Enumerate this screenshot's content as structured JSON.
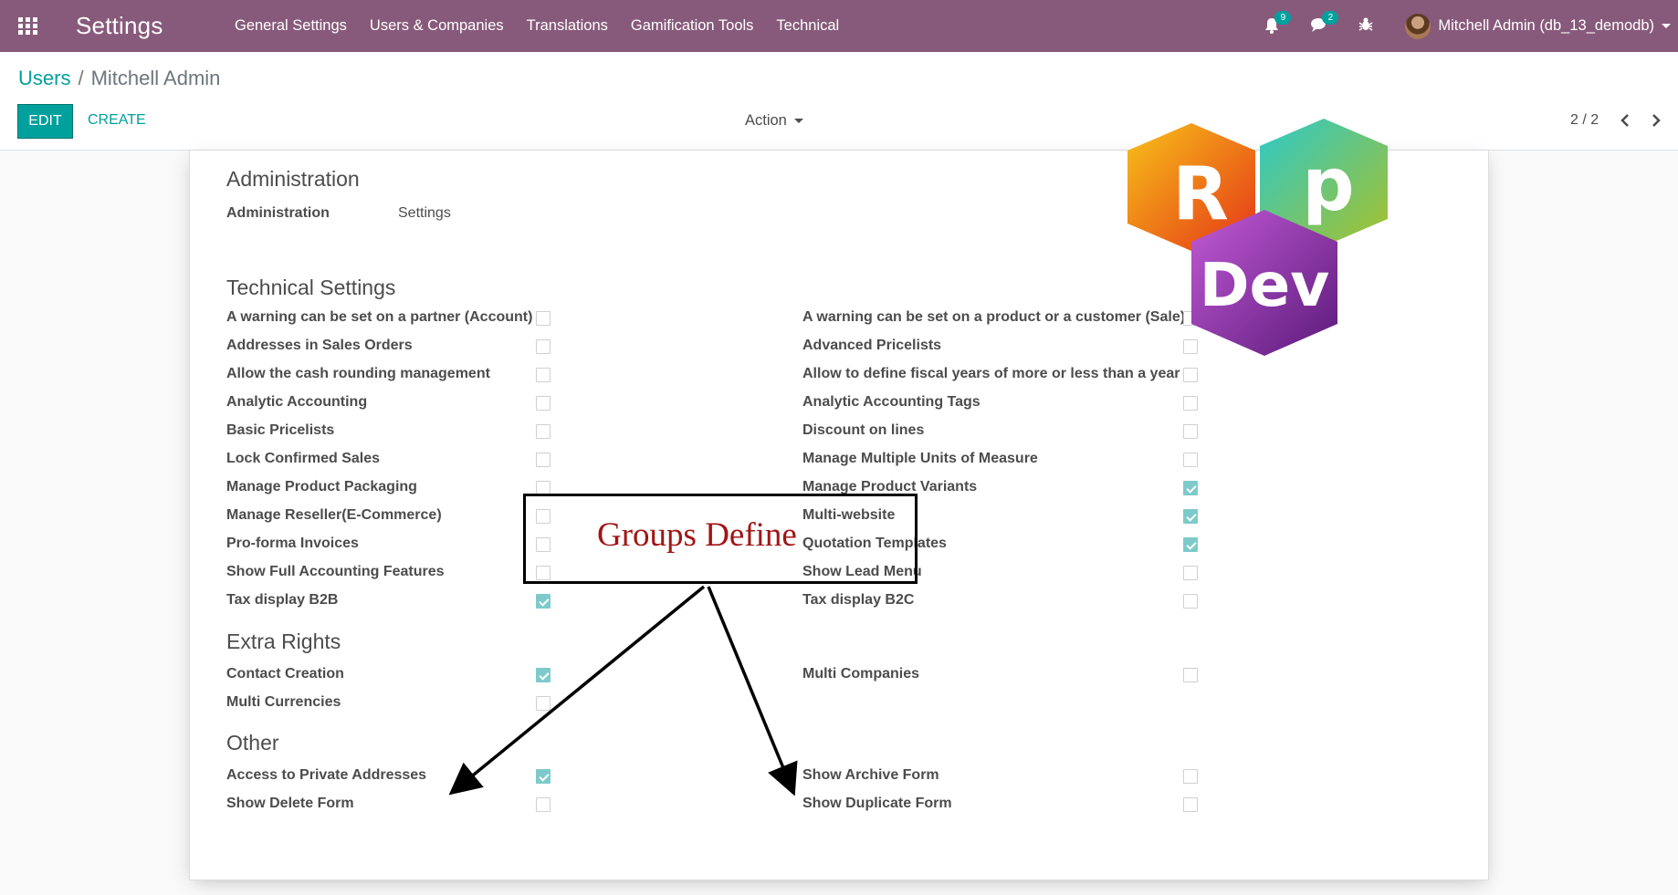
{
  "navbar": {
    "app_title": "Settings",
    "menu": [
      "General Settings",
      "Users & Companies",
      "Translations",
      "Gamification Tools",
      "Technical"
    ],
    "notifications_count": "9",
    "messages_count": "2",
    "user_label": "Mitchell Admin (db_13_demodb)"
  },
  "control": {
    "breadcrumb_parent": "Users",
    "breadcrumb_sep": "/",
    "breadcrumb_current": "Mitchell Admin",
    "edit_label": "EDIT",
    "create_label": "CREATE",
    "action_label": "Action",
    "pager": "2 / 2"
  },
  "admin": {
    "section_title": "Administration",
    "field_label": "Administration",
    "field_value": "Settings"
  },
  "technical": {
    "section_title": "Technical Settings",
    "left": [
      {
        "label": "A warning can be set on a partner (Account)",
        "checked": false
      },
      {
        "label": "Addresses in Sales Orders",
        "checked": false
      },
      {
        "label": "Allow the cash rounding management",
        "checked": false
      },
      {
        "label": "Analytic Accounting",
        "checked": false
      },
      {
        "label": "Basic Pricelists",
        "checked": false
      },
      {
        "label": "Lock Confirmed Sales",
        "checked": false
      },
      {
        "label": "Manage Product Packaging",
        "checked": false
      },
      {
        "label": "Manage Reseller(E-Commerce)",
        "checked": false
      },
      {
        "label": "Pro-forma Invoices",
        "checked": false
      },
      {
        "label": "Show Full Accounting Features",
        "checked": false
      },
      {
        "label": "Tax display B2B",
        "checked": true
      }
    ],
    "right": [
      {
        "label": "A warning can be set on a product or a customer (Sale)",
        "checked": false
      },
      {
        "label": "Advanced Pricelists",
        "checked": false
      },
      {
        "label": "Allow to define fiscal years of more or less than a year",
        "checked": false
      },
      {
        "label": "Analytic Accounting Tags",
        "checked": false
      },
      {
        "label": "Discount on lines",
        "checked": false
      },
      {
        "label": "Manage Multiple Units of Measure",
        "checked": false
      },
      {
        "label": "Manage Product Variants",
        "checked": true
      },
      {
        "label": "Multi-website",
        "checked": true
      },
      {
        "label": "Quotation Templates",
        "checked": true
      },
      {
        "label": "Show Lead Menu",
        "checked": false
      },
      {
        "label": "Tax display B2C",
        "checked": false
      }
    ]
  },
  "extra": {
    "section_title": "Extra Rights",
    "left": [
      {
        "label": "Contact Creation",
        "checked": true
      },
      {
        "label": "Multi Currencies",
        "checked": false
      }
    ],
    "right": [
      {
        "label": "Multi Companies",
        "checked": false
      }
    ]
  },
  "other": {
    "section_title": "Other",
    "left": [
      {
        "label": "Access to Private Addresses",
        "checked": true
      },
      {
        "label": "Show Delete Form",
        "checked": false
      }
    ],
    "right": [
      {
        "label": "Show Archive Form",
        "checked": false
      },
      {
        "label": "Show Duplicate Form",
        "checked": false
      }
    ]
  },
  "annotation": {
    "text": "Groups Define"
  },
  "logo": {
    "letters": [
      "R",
      "p",
      "Dev"
    ],
    "colors": [
      "#e94e1b",
      "#3cc0a6",
      "#8e44ad"
    ]
  },
  "colors": {
    "navbar": "#875a7b",
    "accent": "#00a09d",
    "checked": "#7ecacb",
    "annotation_text": "#a11515"
  }
}
